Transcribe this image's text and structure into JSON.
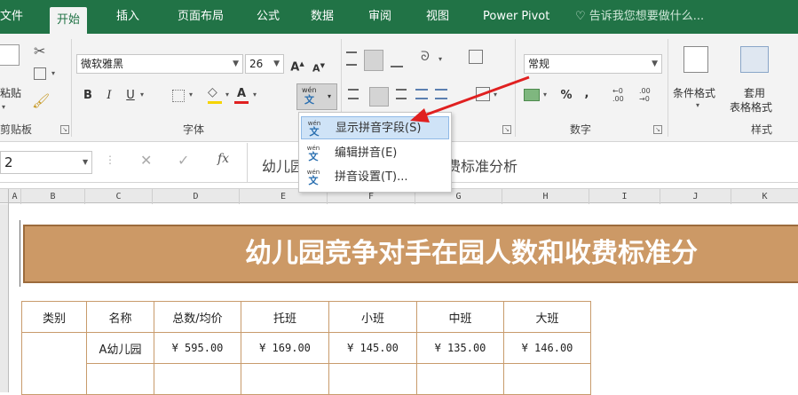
{
  "tabs": [
    "文件",
    "开始",
    "插入",
    "页面布局",
    "公式",
    "数据",
    "审阅",
    "视图",
    "Power Pivot"
  ],
  "active_tab": "开始",
  "tell_me": "告诉我您想要做什么...",
  "ribbon": {
    "clipboard": {
      "paste_label": "粘贴",
      "group_label": "剪贴板"
    },
    "font": {
      "name": "微软雅黑",
      "size": "26",
      "grow": "A",
      "shrink": "A",
      "bold": "B",
      "italic": "I",
      "underline": "U",
      "font_color_letter": "A",
      "phonetic_top": "wén",
      "phonetic_bottom": "文",
      "group_label": "字体"
    },
    "number": {
      "format": "常规",
      "percent": "%",
      "comma": ",",
      "inc_dec": ".00",
      "dec_dec": ".00",
      "group_label": "数字"
    },
    "styles": {
      "cond_format": "条件格式",
      "table_format_1": "套用",
      "table_format_2": "表格格式",
      "group_label": "样式"
    }
  },
  "formula_bar": {
    "name_box": "2",
    "fx": "fx",
    "content": "幼儿园竞争对手在园人数和收费标准分析"
  },
  "columns": [
    "A",
    "B",
    "C",
    "D",
    "E",
    "F",
    "G",
    "H",
    "I",
    "J",
    "K"
  ],
  "sheet": {
    "title": "幼儿园竞争对手在园人数和收费标准分",
    "headers": [
      "类别",
      "名称",
      "总数/均价",
      "托班",
      "小班",
      "中班",
      "大班"
    ],
    "rows": [
      [
        "",
        "A幼儿园",
        "¥ 595.00",
        "¥ 169.00",
        "¥ 145.00",
        "¥ 135.00",
        "¥ 146.00"
      ]
    ]
  },
  "phonetic_menu": {
    "items": [
      {
        "label": "显示拼音字段(S)",
        "icon": "phonetic-show-icon"
      },
      {
        "label": "编辑拼音(E)",
        "icon": "phonetic-edit-icon"
      },
      {
        "label": "拼音设置(T)...",
        "icon": "phonetic-settings-icon"
      }
    ],
    "highlighted_index": 0
  },
  "colors": {
    "ribbon_green": "#217346",
    "banner_fill": "#cc9966",
    "annotation_arrow": "#e02020",
    "table_border": "#c89b6c"
  }
}
